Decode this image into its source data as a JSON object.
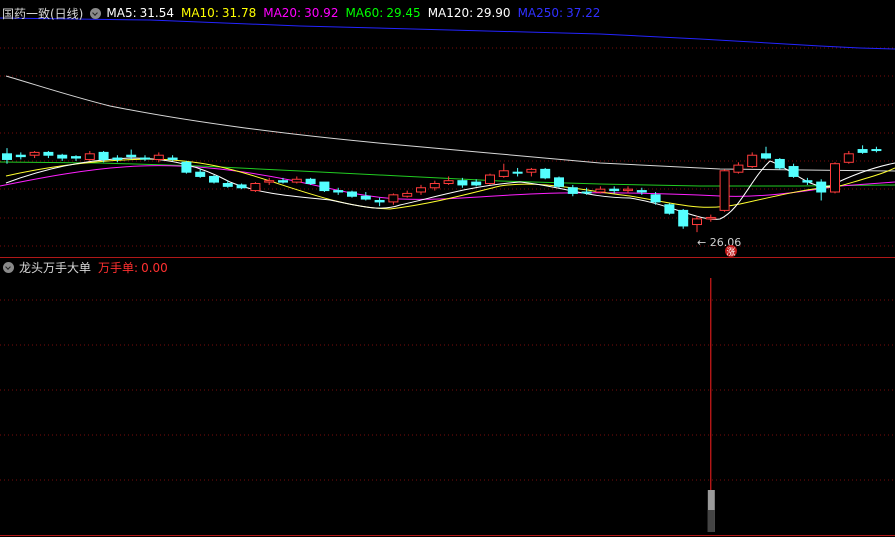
{
  "main_panel": {
    "title": "国药一致(日线)",
    "ma_indicators": [
      {
        "label": "MA5:",
        "value": "31.54",
        "color": "#ffffff"
      },
      {
        "label": "MA10:",
        "value": "31.78",
        "color": "#ffff00"
      },
      {
        "label": "MA20:",
        "value": "30.92",
        "color": "#ff00ff"
      },
      {
        "label": "MA60:",
        "value": "29.45",
        "color": "#00ff00"
      },
      {
        "label": "MA120:",
        "value": "29.90",
        "color": "#ffffff"
      },
      {
        "label": "MA250:",
        "value": "37.22",
        "color": "#0000ff"
      }
    ],
    "low_marker": "← 26.06",
    "badge": "涨"
  },
  "sub_panel": {
    "title": "龙头万手大单",
    "indicator_label": "万手单:",
    "indicator_value": "0.00",
    "indicator_color": "#ff3030"
  },
  "chart_data": {
    "type": "candlestick",
    "y_range": [
      24.8,
      41.2
    ],
    "candles": [
      {
        "o": 31.2,
        "c": 31.6,
        "h": 32.0,
        "l": 30.9,
        "up": false
      },
      {
        "o": 31.5,
        "c": 31.4,
        "h": 31.7,
        "l": 31.2,
        "up": false
      },
      {
        "o": 31.5,
        "c": 31.7,
        "h": 31.8,
        "l": 31.3,
        "up": true
      },
      {
        "o": 31.7,
        "c": 31.5,
        "h": 31.8,
        "l": 31.3,
        "up": false
      },
      {
        "o": 31.5,
        "c": 31.3,
        "h": 31.6,
        "l": 31.1,
        "up": false
      },
      {
        "o": 31.3,
        "c": 31.4,
        "h": 31.5,
        "l": 31.1,
        "up": false
      },
      {
        "o": 31.2,
        "c": 31.6,
        "h": 31.8,
        "l": 31.1,
        "up": true
      },
      {
        "o": 31.7,
        "c": 31.2,
        "h": 31.8,
        "l": 31.0,
        "up": false
      },
      {
        "o": 31.2,
        "c": 31.3,
        "h": 31.5,
        "l": 31.0,
        "up": false
      },
      {
        "o": 31.4,
        "c": 31.5,
        "h": 31.9,
        "l": 31.2,
        "up": false
      },
      {
        "o": 31.3,
        "c": 31.3,
        "h": 31.5,
        "l": 31.1,
        "up": false
      },
      {
        "o": 31.2,
        "c": 31.5,
        "h": 31.7,
        "l": 31.0,
        "up": true
      },
      {
        "o": 31.3,
        "c": 31.2,
        "h": 31.5,
        "l": 31.1,
        "up": false
      },
      {
        "o": 31.0,
        "c": 30.3,
        "h": 31.1,
        "l": 30.2,
        "up": false
      },
      {
        "o": 30.3,
        "c": 30.0,
        "h": 30.5,
        "l": 29.9,
        "up": false
      },
      {
        "o": 30.0,
        "c": 29.6,
        "h": 30.1,
        "l": 29.5,
        "up": false
      },
      {
        "o": 29.5,
        "c": 29.3,
        "h": 29.7,
        "l": 29.2,
        "up": false
      },
      {
        "o": 29.4,
        "c": 29.2,
        "h": 29.5,
        "l": 29.1,
        "up": false
      },
      {
        "o": 29.0,
        "c": 29.5,
        "h": 29.6,
        "l": 28.9,
        "up": true
      },
      {
        "o": 29.6,
        "c": 29.7,
        "h": 29.9,
        "l": 29.4,
        "up": true
      },
      {
        "o": 29.7,
        "c": 29.6,
        "h": 29.9,
        "l": 29.5,
        "up": false
      },
      {
        "o": 29.6,
        "c": 29.8,
        "h": 30.0,
        "l": 29.5,
        "up": true
      },
      {
        "o": 29.8,
        "c": 29.5,
        "h": 29.9,
        "l": 29.4,
        "up": false
      },
      {
        "o": 29.6,
        "c": 29.0,
        "h": 29.6,
        "l": 28.9,
        "up": false
      },
      {
        "o": 29.0,
        "c": 28.9,
        "h": 29.2,
        "l": 28.7,
        "up": false
      },
      {
        "o": 28.9,
        "c": 28.6,
        "h": 29.0,
        "l": 28.5,
        "up": false
      },
      {
        "o": 28.6,
        "c": 28.4,
        "h": 28.9,
        "l": 28.3,
        "up": false
      },
      {
        "o": 28.3,
        "c": 28.2,
        "h": 28.5,
        "l": 27.9,
        "up": false
      },
      {
        "o": 28.2,
        "c": 28.7,
        "h": 28.8,
        "l": 28.0,
        "up": true
      },
      {
        "o": 28.6,
        "c": 28.8,
        "h": 29.0,
        "l": 28.5,
        "up": true
      },
      {
        "o": 28.9,
        "c": 29.2,
        "h": 29.4,
        "l": 28.7,
        "up": true
      },
      {
        "o": 29.2,
        "c": 29.5,
        "h": 29.7,
        "l": 29.0,
        "up": true
      },
      {
        "o": 29.5,
        "c": 29.7,
        "h": 30.0,
        "l": 29.4,
        "up": true
      },
      {
        "o": 29.7,
        "c": 29.4,
        "h": 29.9,
        "l": 29.2,
        "up": false
      },
      {
        "o": 29.4,
        "c": 29.6,
        "h": 29.8,
        "l": 29.3,
        "up": false
      },
      {
        "o": 29.5,
        "c": 30.1,
        "h": 30.2,
        "l": 29.4,
        "up": true
      },
      {
        "o": 30.0,
        "c": 30.4,
        "h": 30.9,
        "l": 29.9,
        "up": true
      },
      {
        "o": 30.3,
        "c": 30.3,
        "h": 30.6,
        "l": 30.0,
        "up": false
      },
      {
        "o": 30.3,
        "c": 30.5,
        "h": 30.6,
        "l": 30.0,
        "up": true
      },
      {
        "o": 30.5,
        "c": 29.9,
        "h": 30.6,
        "l": 29.8,
        "up": false
      },
      {
        "o": 29.9,
        "c": 29.3,
        "h": 30.0,
        "l": 29.2,
        "up": false
      },
      {
        "o": 29.2,
        "c": 28.8,
        "h": 29.4,
        "l": 28.6,
        "up": false
      },
      {
        "o": 28.9,
        "c": 28.9,
        "h": 29.2,
        "l": 28.7,
        "up": false
      },
      {
        "o": 28.9,
        "c": 29.1,
        "h": 29.3,
        "l": 28.8,
        "up": true
      },
      {
        "o": 29.1,
        "c": 29.0,
        "h": 29.3,
        "l": 28.8,
        "up": false
      },
      {
        "o": 29.0,
        "c": 29.1,
        "h": 29.3,
        "l": 28.8,
        "up": true
      },
      {
        "o": 29.0,
        "c": 28.9,
        "h": 29.2,
        "l": 28.7,
        "up": false
      },
      {
        "o": 28.7,
        "c": 28.2,
        "h": 28.9,
        "l": 28.0,
        "up": false
      },
      {
        "o": 28.0,
        "c": 27.4,
        "h": 28.1,
        "l": 27.3,
        "up": false
      },
      {
        "o": 27.6,
        "c": 26.5,
        "h": 27.7,
        "l": 26.3,
        "up": false
      },
      {
        "o": 26.6,
        "c": 27.0,
        "h": 27.2,
        "l": 26.06,
        "up": true
      },
      {
        "o": 27.0,
        "c": 27.1,
        "h": 27.3,
        "l": 26.8,
        "up": true
      },
      {
        "o": 27.6,
        "c": 30.4,
        "h": 30.5,
        "l": 27.5,
        "up": true
      },
      {
        "o": 30.3,
        "c": 30.8,
        "h": 31.0,
        "l": 30.2,
        "up": true
      },
      {
        "o": 30.7,
        "c": 31.5,
        "h": 31.7,
        "l": 30.6,
        "up": true
      },
      {
        "o": 31.6,
        "c": 31.3,
        "h": 32.1,
        "l": 31.2,
        "up": false
      },
      {
        "o": 31.2,
        "c": 30.6,
        "h": 31.3,
        "l": 30.5,
        "up": false
      },
      {
        "o": 30.7,
        "c": 30.0,
        "h": 30.9,
        "l": 29.9,
        "up": false
      },
      {
        "o": 29.7,
        "c": 29.6,
        "h": 29.9,
        "l": 29.4,
        "up": false
      },
      {
        "o": 29.6,
        "c": 28.9,
        "h": 29.8,
        "l": 28.3,
        "up": false
      },
      {
        "o": 28.9,
        "c": 30.9,
        "h": 31.0,
        "l": 28.8,
        "up": true
      },
      {
        "o": 31.0,
        "c": 31.6,
        "h": 31.8,
        "l": 30.9,
        "up": true
      },
      {
        "o": 31.7,
        "c": 31.9,
        "h": 32.2,
        "l": 31.6,
        "up": false
      },
      {
        "o": 31.9,
        "c": 31.9,
        "h": 32.1,
        "l": 31.7,
        "up": false
      }
    ],
    "sub_panel_values": {
      "spike_index": 51,
      "y_range": [
        0,
        1
      ]
    }
  }
}
